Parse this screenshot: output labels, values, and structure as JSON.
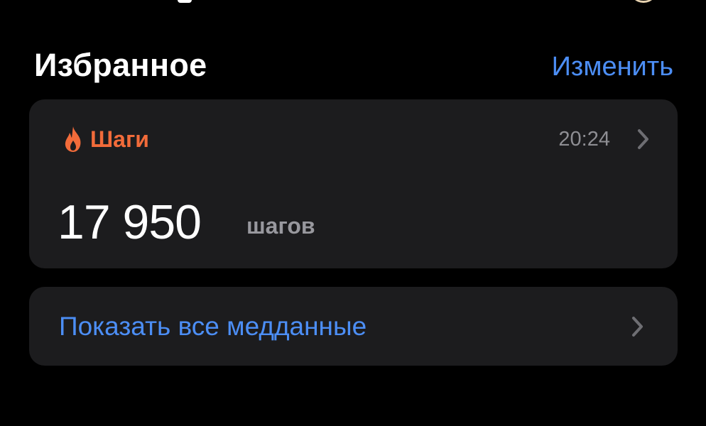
{
  "favorites": {
    "title": "Избранное",
    "edit_label": "Изменить"
  },
  "steps_card": {
    "icon": "flame-icon",
    "label": "Шаги",
    "time": "20:24",
    "value": "17 950",
    "unit": "шагов"
  },
  "show_all": {
    "label": "Показать все медданные",
    "icon": "chevron-right-icon"
  },
  "colors": {
    "background": "#000000",
    "card": "#1c1c1e",
    "accent_blue": "#4c8ef5",
    "activity_orange": "#f26b3a",
    "secondary_text": "#8e8e93"
  }
}
